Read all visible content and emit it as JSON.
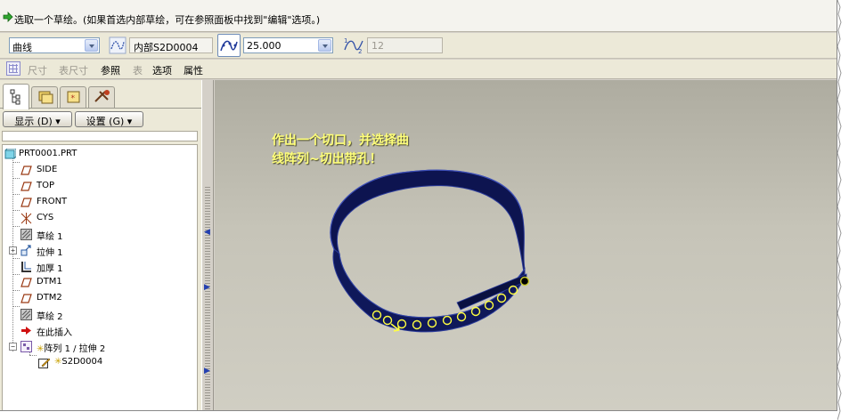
{
  "message": {
    "text": "选取一个草绘。(如果首选内部草绘，可在参照面板中找到\"编辑\"选项。)"
  },
  "dashboard": {
    "curve_type": "曲线",
    "sketch_ref": "内部S2D0004",
    "spacing_value": "25.000",
    "count_value": "12"
  },
  "tabs": [
    {
      "label": "尺寸",
      "enabled": false
    },
    {
      "label": "表尺寸",
      "enabled": false
    },
    {
      "label": "参照",
      "enabled": true
    },
    {
      "label": "表",
      "enabled": false
    },
    {
      "label": "选项",
      "enabled": true
    },
    {
      "label": "属性",
      "enabled": true
    }
  ],
  "panel": {
    "show_button": "显示 (D)",
    "settings_button": "设置 (G)"
  },
  "tree": {
    "root": "PRT0001.PRT",
    "items": [
      {
        "label": "SIDE",
        "icon": "datum-plane-icon"
      },
      {
        "label": "TOP",
        "icon": "datum-plane-icon"
      },
      {
        "label": "FRONT",
        "icon": "datum-plane-icon"
      },
      {
        "label": "CYS",
        "icon": "coordinate-system-icon"
      },
      {
        "label": "草绘 1",
        "icon": "sketch-icon"
      },
      {
        "label": "拉伸 1",
        "icon": "extrude-icon"
      },
      {
        "label": "加厚 1",
        "icon": "thicken-icon"
      },
      {
        "label": "DTM1",
        "icon": "datum-plane-icon"
      },
      {
        "label": "DTM2",
        "icon": "datum-plane-icon"
      },
      {
        "label": "草绘 2",
        "icon": "sketch-icon"
      },
      {
        "label": "在此插入",
        "icon": "insert-here-arrow-icon"
      },
      {
        "label": "阵列 1 / 拉伸 2",
        "icon": "pattern-icon"
      },
      {
        "label": "S2D0004",
        "icon": "sketch-edit-icon"
      }
    ]
  },
  "viewport": {
    "annotation_line1": "作出一个切口，并选择曲",
    "annotation_line2": "线阵列~切出带孔！"
  },
  "colors": {
    "model": "#0d1450",
    "annotation": "#ffff7a",
    "point": "#ffff40"
  }
}
